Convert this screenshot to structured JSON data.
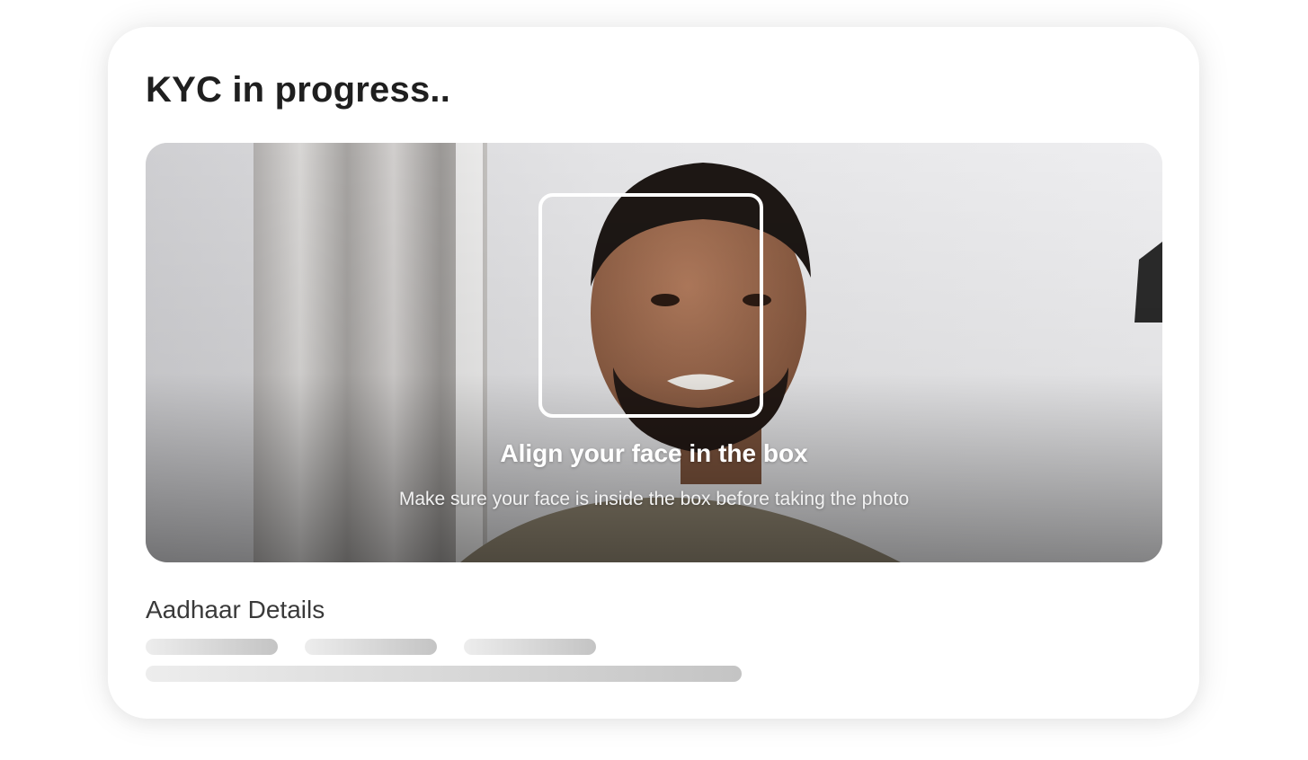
{
  "kyc_card": {
    "title": "KYC in progress..",
    "camera": {
      "instruction_title": "Align your face in the box",
      "instruction_subtitle": "Make sure your face is inside the box before taking the photo"
    },
    "aadhaar_section": {
      "title": "Aadhaar Details"
    }
  }
}
